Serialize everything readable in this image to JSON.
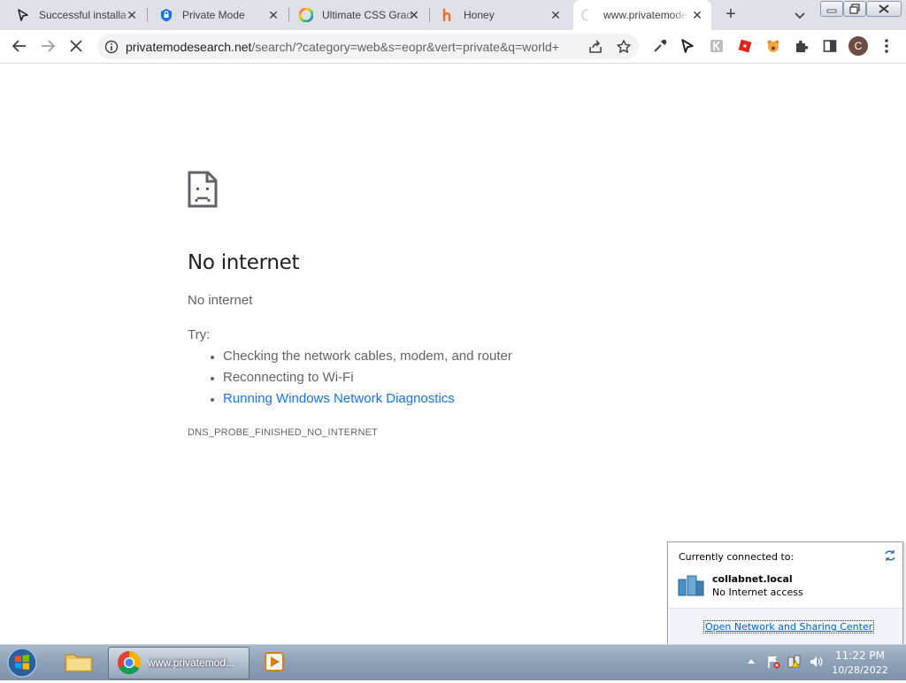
{
  "browser": {
    "tabs": [
      {
        "title": "Successful installa",
        "icon": "cursor-arrow-icon"
      },
      {
        "title": "Private Mode",
        "icon": "private-shield-icon"
      },
      {
        "title": "Ultimate CSS Grad",
        "icon": "color-wheel-icon"
      },
      {
        "title": "Honey",
        "icon": "honey-h-icon"
      },
      {
        "title": "www.privatemode",
        "icon": "loading-spinner-icon",
        "active": true
      }
    ],
    "url_domain": "privatemodesearch.net",
    "url_rest": "/search/?category=web&s=eopr&vert=private&q=world+...",
    "profile_initial": "C"
  },
  "error_page": {
    "heading": "No internet",
    "subheading": "No internet",
    "try_label": "Try:",
    "suggestions": [
      "Checking the network cables, modem, and router",
      "Reconnecting to Wi-Fi",
      "Running Windows Network Diagnostics"
    ],
    "error_code": "DNS_PROBE_FINISHED_NO_INTERNET"
  },
  "network_popup": {
    "header": "Currently connected to:",
    "network_name": "collabnet.local",
    "status": "No Internet access",
    "link": "Open Network and Sharing Center"
  },
  "taskbar": {
    "chrome_label": "www.privatemod...",
    "time": "11:22 PM",
    "date": "10/28/2022"
  },
  "colors": {
    "link_blue": "#1a73e8",
    "text_gray": "#5f6368",
    "tabstrip_bg": "#dee1e6"
  }
}
